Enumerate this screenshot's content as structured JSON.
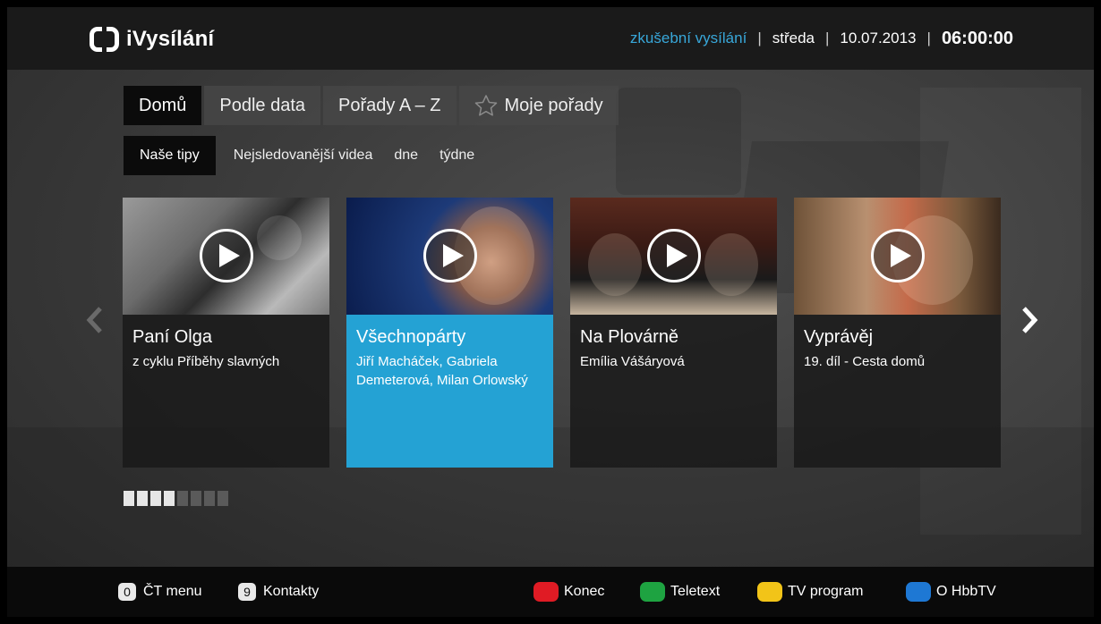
{
  "header": {
    "logo_text": "iVysílání",
    "status": {
      "mode": "zkušební vysílání",
      "separator": "|",
      "day": "středa",
      "date": "10.07.2013",
      "time": "06:00:00"
    }
  },
  "tabs": [
    {
      "label": "Domů",
      "active": true
    },
    {
      "label": "Podle data"
    },
    {
      "label": "Pořady A – Z"
    },
    {
      "label": "Moje pořady",
      "icon": "star-outline-icon"
    }
  ],
  "subtabs": [
    {
      "label": "Naše tipy",
      "active": true
    },
    {
      "label": "Nejsledovanější videa"
    },
    {
      "label": "dne"
    },
    {
      "label": "týdne"
    }
  ],
  "cards": [
    {
      "title": "Paní Olga",
      "subtitle": "z cyklu Příběhy slavných"
    },
    {
      "title": "Všechnopárty",
      "subtitle": "Jiří Macháček, Gabriela Demeterová, Milan Orlowský",
      "selected": true
    },
    {
      "title": "Na Plovárně",
      "subtitle": "Emília Vášáryová"
    },
    {
      "title": "Vyprávěj",
      "subtitle": "19. díl - Cesta domů"
    }
  ],
  "pager": {
    "total": 8,
    "active_count": 4
  },
  "footer": {
    "keys": [
      {
        "key": "0",
        "label": "ČT menu"
      },
      {
        "key": "9",
        "label": "Kontakty"
      }
    ],
    "color_buttons": [
      {
        "color": "#e01b24",
        "label": "Konec"
      },
      {
        "color": "#1ea341",
        "label": "Teletext"
      },
      {
        "color": "#f2c418",
        "label": "TV program"
      },
      {
        "color": "#1e78d4",
        "label": "O HbbTV"
      }
    ]
  },
  "colors": {
    "accent": "#24a2d4",
    "status_mode": "#38a7d9"
  }
}
